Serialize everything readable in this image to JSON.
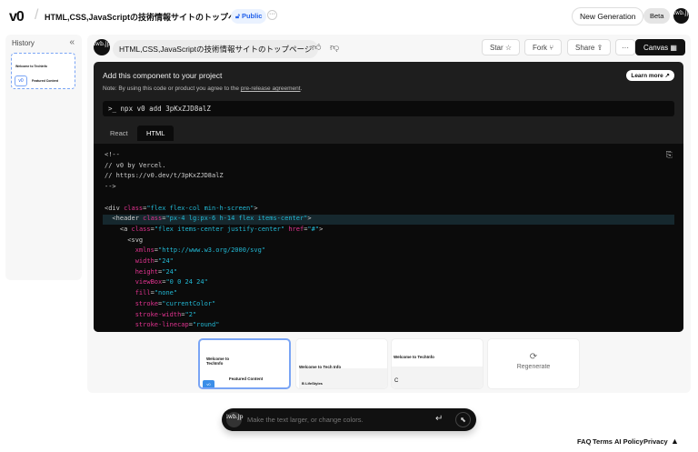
{
  "header": {
    "logo": "v0",
    "title": "HTML,CSS,JavaScriptの技術情報サイトのトップページ",
    "visibility": "Public",
    "new_generation": "New Generation",
    "beta": "Beta",
    "avatar_text": "iwb.jp"
  },
  "sidebar": {
    "title": "History",
    "collapse": "«",
    "thumb_title": "Welcome to TechInfo",
    "thumb_badge": "v0",
    "thumb_section": "Featured Content"
  },
  "chat": {
    "prompt": "HTML,CSS,JavaScriptの技術情報サイトのトップページ"
  },
  "toolbar": {
    "star": "Star",
    "fork": "Fork",
    "share": "Share",
    "more": "···",
    "canvas": "Canvas"
  },
  "install": {
    "title": "Add this component to your project",
    "note_prefix": "Note: By using this code or product you agree to the ",
    "note_link": "pre-release agreement",
    "note_suffix": ".",
    "learn_more": "Learn more ↗",
    "command_prompt": ">_",
    "command": "npx v0 add 3pKxZJD8alZ"
  },
  "tabs": [
    {
      "label": "React"
    },
    {
      "label": "HTML"
    }
  ],
  "code_lines": [
    [
      [
        "t",
        "<!--"
      ]
    ],
    [
      [
        "t",
        "// v0 by Vercel."
      ]
    ],
    [
      [
        "t",
        "// https://v0.dev/t/3pKxZJD8alZ"
      ]
    ],
    [
      [
        "t",
        "-->"
      ]
    ],
    [],
    [
      [
        "t",
        "<div "
      ],
      [
        "k",
        "class"
      ],
      [
        "t",
        "="
      ],
      [
        "s",
        "\"flex flex-col min-h-screen\""
      ],
      [
        "t",
        ">"
      ]
    ],
    [
      [
        "t",
        "  <header "
      ],
      [
        "k",
        "class"
      ],
      [
        "t",
        "="
      ],
      [
        "s",
        "\"px-4 lg:px-6 h-14 flex items-center\""
      ],
      [
        "t",
        ">"
      ]
    ],
    [
      [
        "t",
        "    <a "
      ],
      [
        "k",
        "class"
      ],
      [
        "t",
        "="
      ],
      [
        "s",
        "\"flex items-center justify-center\""
      ],
      [
        "t",
        " "
      ],
      [
        "k",
        "href"
      ],
      [
        "t",
        "="
      ],
      [
        "s",
        "\"#\""
      ],
      [
        "t",
        ">"
      ]
    ],
    [
      [
        "t",
        "      <svg"
      ]
    ],
    [
      [
        "k",
        "        xmlns"
      ],
      [
        "t",
        "="
      ],
      [
        "s",
        "\"http://www.w3.org/2000/svg\""
      ]
    ],
    [
      [
        "k",
        "        width"
      ],
      [
        "t",
        "="
      ],
      [
        "s",
        "\"24\""
      ]
    ],
    [
      [
        "k",
        "        height"
      ],
      [
        "t",
        "="
      ],
      [
        "s",
        "\"24\""
      ]
    ],
    [
      [
        "k",
        "        viewBox"
      ],
      [
        "t",
        "="
      ],
      [
        "s",
        "\"0 0 24 24\""
      ]
    ],
    [
      [
        "k",
        "        fill"
      ],
      [
        "t",
        "="
      ],
      [
        "s",
        "\"none\""
      ]
    ],
    [
      [
        "k",
        "        stroke"
      ],
      [
        "t",
        "="
      ],
      [
        "s",
        "\"currentColor\""
      ]
    ],
    [
      [
        "k",
        "        stroke-width"
      ],
      [
        "t",
        "="
      ],
      [
        "s",
        "\"2\""
      ]
    ],
    [
      [
        "k",
        "        stroke-linecap"
      ],
      [
        "t",
        "="
      ],
      [
        "s",
        "\"round\""
      ]
    ]
  ],
  "versions": [
    {
      "title": "Welcome to TechInfo",
      "section": "Featured Content",
      "badge": "v0"
    },
    {
      "title": "Welcome to Tech Info",
      "section": "B  LifeStyles"
    },
    {
      "title": "Welcome to TechInfo",
      "section": "C"
    }
  ],
  "regenerate": "Regenerate",
  "input": {
    "placeholder": "Make the text larger, or change colors.",
    "avatar_text": "iwb.jp",
    "enter": "↵"
  },
  "footer": {
    "links": [
      "FAQ",
      "Terms",
      "AI Policy",
      "Privacy"
    ]
  }
}
